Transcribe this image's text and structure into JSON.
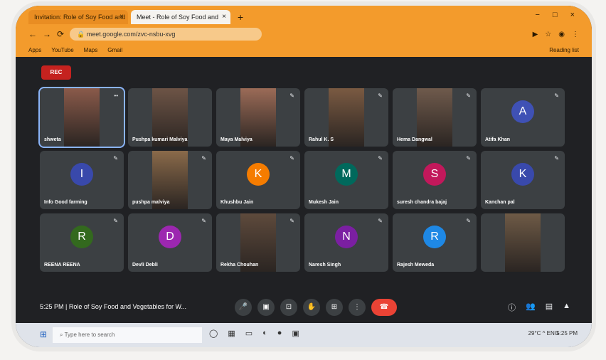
{
  "browser": {
    "tabs": [
      {
        "label": "Invitation: Role of Soy Food and",
        "close": "×"
      },
      {
        "label": "Meet - Role of Soy Food and",
        "close": "×"
      }
    ],
    "new_tab": "+",
    "window_controls": [
      "−",
      "□",
      "×"
    ],
    "address": "meet.google.com/zvc-nsbu-xvg",
    "bookmarks": [
      "Apps",
      "YouTube",
      "Maps",
      "Gmail"
    ],
    "reading_list": "Reading list"
  },
  "meet": {
    "rec_label": "REC",
    "participants": [
      {
        "name": "shweta",
        "type": "video",
        "speaking": true,
        "mic": "••"
      },
      {
        "name": "Pushpa kumari Malviya",
        "type": "video",
        "mic": ""
      },
      {
        "name": "Maya Malviya",
        "type": "video",
        "mic": "✎"
      },
      {
        "name": "Rahul K. S",
        "type": "video",
        "mic": "✎"
      },
      {
        "name": "Hema Dangwal",
        "type": "video",
        "mic": "✎"
      },
      {
        "name": "Atifa Khan",
        "type": "avatar",
        "initial": "A",
        "color": "#3f51b5",
        "mic": "✎"
      },
      {
        "name": "Info Good farming",
        "type": "avatar",
        "initial": "I",
        "color": "#3949ab",
        "mic": "✎"
      },
      {
        "name": "pushpa malviya",
        "type": "video",
        "mic": "✎"
      },
      {
        "name": "Khushbu Jain",
        "type": "avatar",
        "initial": "K",
        "color": "#f57c00",
        "mic": "✎"
      },
      {
        "name": "Mukesh Jain",
        "type": "avatar",
        "initial": "M",
        "color": "#00695c",
        "mic": "✎"
      },
      {
        "name": "suresh chandra bajaj",
        "type": "avatar",
        "initial": "S",
        "color": "#c2185b",
        "mic": "✎"
      },
      {
        "name": "Kanchan pal",
        "type": "avatar",
        "initial": "K",
        "color": "#3949ab",
        "mic": "✎"
      },
      {
        "name": "REENA REENA",
        "type": "avatar",
        "initial": "R",
        "color": "#33691e",
        "mic": "✎"
      },
      {
        "name": "Devli Debli",
        "type": "avatar",
        "initial": "D",
        "color": "#9c27b0",
        "mic": "✎"
      },
      {
        "name": "Rekha Chouhan",
        "type": "video",
        "mic": "✎"
      },
      {
        "name": "Naresh Singh",
        "type": "avatar",
        "initial": "N",
        "color": "#7b1fa2",
        "mic": "✎"
      },
      {
        "name": "Rajesh Meweda",
        "type": "avatar",
        "initial": "R",
        "color": "#1e88e5",
        "mic": "✎"
      },
      {
        "name": "",
        "type": "video",
        "mic": ""
      }
    ]
  },
  "controls": {
    "time": "5:25 PM",
    "separator": "|",
    "meeting_title": "Role of Soy Food and Vegetables for W...",
    "buttons": [
      "mic",
      "camera",
      "captions",
      "raise-hand",
      "present",
      "more",
      "end-call"
    ],
    "right_buttons": [
      "info",
      "people",
      "chat",
      "activities"
    ]
  },
  "taskbar": {
    "search_placeholder": "Type here to search",
    "tray_text": "29°C ^ ENG",
    "clock": "5:25 PM"
  }
}
